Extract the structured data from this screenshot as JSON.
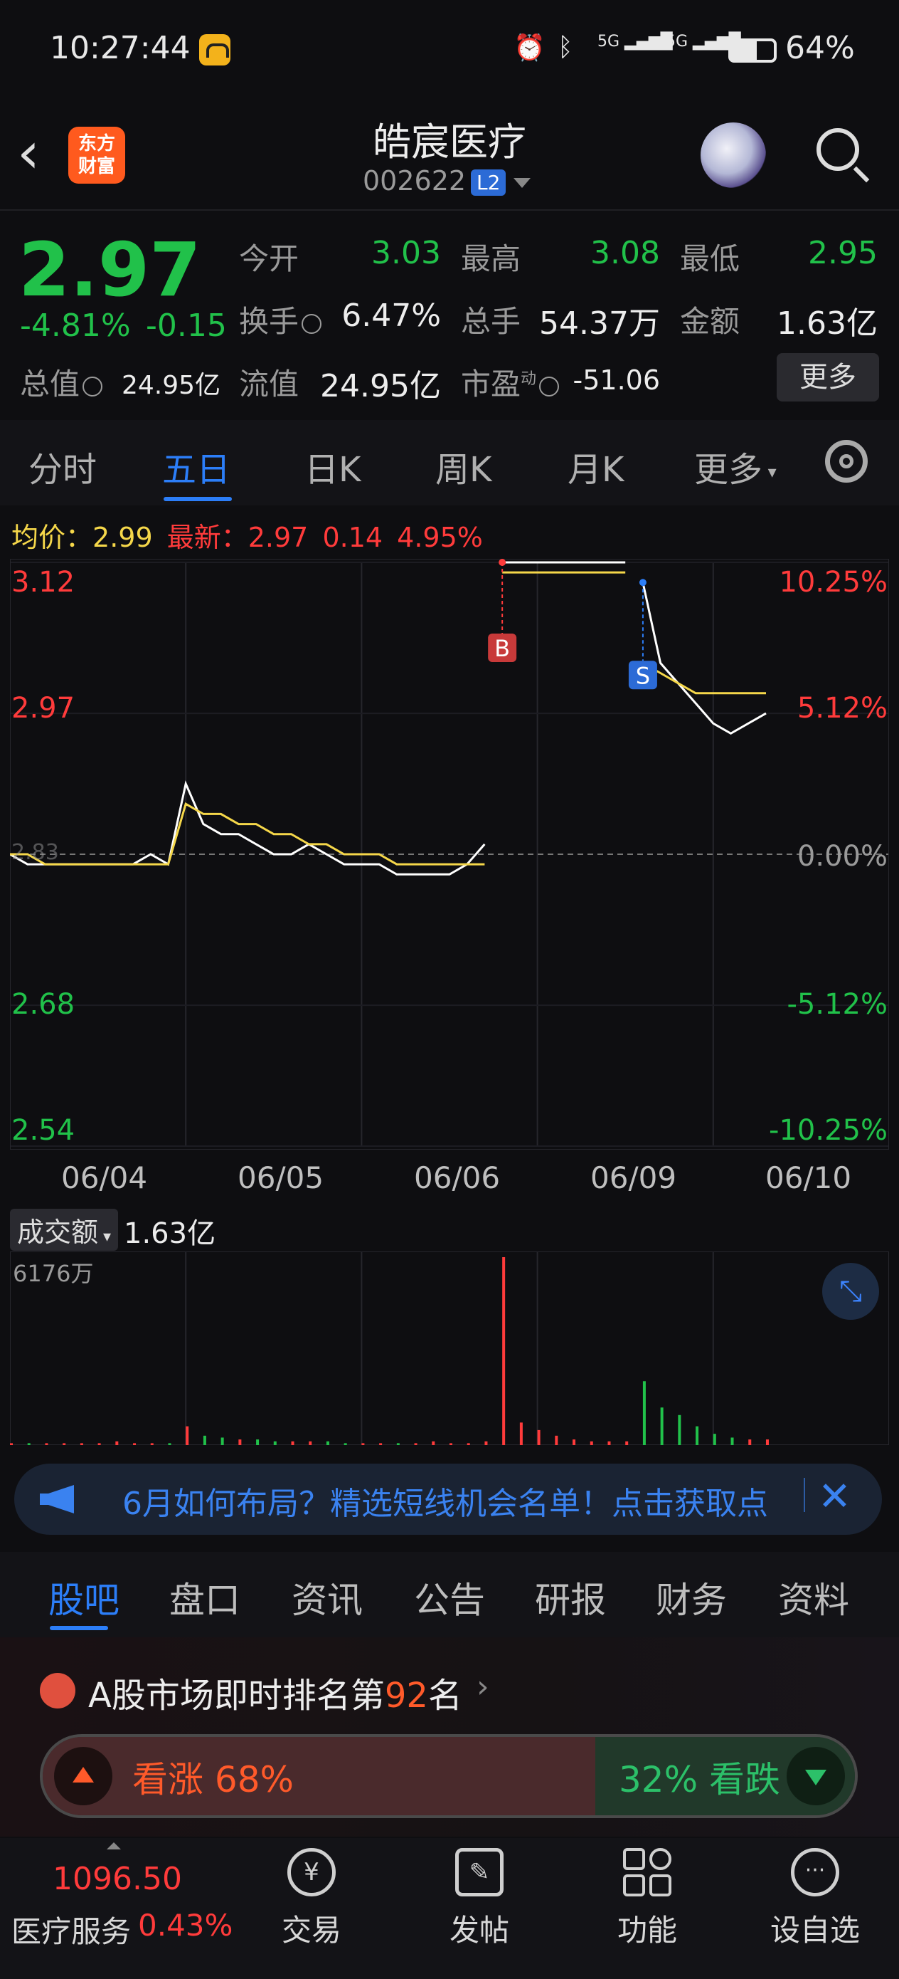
{
  "status_bar": {
    "time": "10:27:44",
    "battery": "64%",
    "net1": "5G",
    "net2": "5G"
  },
  "header": {
    "title": "皓宸医疗",
    "code": "002622",
    "level_badge": "L2",
    "logo_line1": "东方",
    "logo_line2": "财富"
  },
  "quote": {
    "price": "2.97",
    "change_pct": "-4.81%",
    "change": "-0.15",
    "open_label": "今开",
    "open": "3.03",
    "high_label": "最高",
    "high": "3.08",
    "low_label": "最低",
    "low": "2.95",
    "turnover_label": "换手",
    "turnover": "6.47%",
    "volume_label": "总手",
    "volume": "54.37万",
    "amount_label": "金额",
    "amount": "1.63亿",
    "mktcap_label": "总值",
    "mktcap": "24.95亿",
    "float_label": "流值",
    "float": "24.95亿",
    "pe_label": "市盈",
    "pe_sup": "动",
    "pe": "-51.06",
    "more_button": "更多"
  },
  "chart_tabs": [
    "分时",
    "五日",
    "日K",
    "周K",
    "月K",
    "更多"
  ],
  "chart_tabs_selected": "五日",
  "avg_bar": {
    "avg_label": "均价：",
    "avg": "2.99",
    "latest_label": "最新：",
    "latest": "2.97",
    "delta": "0.14",
    "delta_pct": "4.95%"
  },
  "chart_data": {
    "type": "line",
    "title": "",
    "x_labels": [
      "06/04",
      "06/05",
      "06/06",
      "06/09",
      "06/10"
    ],
    "y_left_ticks": [
      "3.12",
      "2.97",
      "2.83",
      "2.68",
      "2.54"
    ],
    "y_right_ticks": [
      "10.25%",
      "5.12%",
      "0.00%",
      "-5.12%",
      "-10.25%"
    ],
    "ylim": [
      2.54,
      3.12
    ],
    "prev_close": 2.83,
    "series": [
      {
        "values": [
          2.83,
          2.82,
          2.82,
          2.82,
          2.82,
          2.82,
          2.82,
          2.82,
          2.83,
          2.82,
          2.9,
          2.86,
          2.85,
          2.85,
          2.84,
          2.83,
          2.83,
          2.84,
          2.83,
          2.82,
          2.82,
          2.82,
          2.81,
          2.81,
          2.81,
          2.81,
          2.82,
          2.84,
          3.12,
          3.12,
          3.12,
          3.12,
          3.12,
          3.12,
          3.12,
          3.12,
          3.1,
          3.02,
          3.0,
          2.98,
          2.96,
          2.95,
          2.96,
          2.97
        ]
      },
      {
        "values": [
          2.83,
          2.83,
          2.82,
          2.82,
          2.82,
          2.82,
          2.82,
          2.82,
          2.82,
          2.82,
          2.88,
          2.87,
          2.87,
          2.86,
          2.86,
          2.85,
          2.85,
          2.84,
          2.84,
          2.83,
          2.83,
          2.83,
          2.82,
          2.82,
          2.82,
          2.82,
          2.82,
          2.82,
          3.11,
          3.11,
          3.11,
          3.11,
          3.11,
          3.11,
          3.11,
          3.11,
          3.02,
          3.01,
          3.0,
          2.99,
          2.99,
          2.99,
          2.99,
          2.99
        ]
      }
    ],
    "markers": [
      {
        "label": "B",
        "at_index": 28
      },
      {
        "label": "S",
        "at_index": 36
      }
    ],
    "grid": true
  },
  "volume": {
    "metric": "成交额",
    "total": "1.63亿",
    "max_label": "6176万",
    "bars": [
      0.01,
      0.01,
      0.01,
      0.01,
      0.01,
      0.01,
      0.02,
      0.01,
      0.01,
      0.01,
      0.1,
      0.05,
      0.04,
      0.03,
      0.03,
      0.02,
      0.02,
      0.02,
      0.02,
      0.01,
      0.01,
      0.01,
      0.01,
      0.01,
      0.02,
      0.01,
      0.01,
      0.02,
      1.0,
      0.12,
      0.08,
      0.05,
      0.03,
      0.02,
      0.02,
      0.02,
      0.34,
      0.2,
      0.16,
      0.1,
      0.06,
      0.04,
      0.03,
      0.03
    ]
  },
  "banner": {
    "text": "6月如何布局？精选短线机会名单！点击获取点"
  },
  "section_tabs": [
    "股吧",
    "盘口",
    "资讯",
    "公告",
    "研报",
    "财务",
    "资料"
  ],
  "ranking": {
    "prefix": "A股市场即时排名第",
    "rank": "92",
    "suffix": "名"
  },
  "vote": {
    "up_label": "看涨 68%",
    "down_label": "32% 看跌",
    "up_pct": 68,
    "down_pct": 32
  },
  "bottom_nav": {
    "index_value": "1096.50",
    "index_name": "医疗服务",
    "index_pct": "0.43%",
    "items": [
      "交易",
      "发帖",
      "功能",
      "设自选"
    ]
  },
  "colors": {
    "up": "#ff3b3b",
    "down": "#21c14a",
    "accent": "#2c7ef8",
    "avg_line": "#f5d74a"
  }
}
